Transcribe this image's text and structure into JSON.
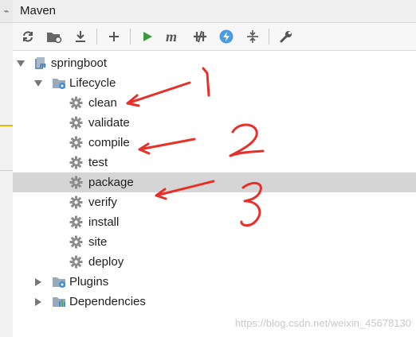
{
  "panel": {
    "title": "Maven"
  },
  "toolbar": {
    "buttons": [
      {
        "name": "reimport-icon"
      },
      {
        "name": "generate-sources-icon"
      },
      {
        "name": "download-icon"
      },
      {
        "name": "add-icon"
      },
      {
        "name": "run-icon"
      },
      {
        "name": "execute-goal-icon"
      },
      {
        "name": "toggle-offline-icon"
      },
      {
        "name": "skip-tests-icon"
      },
      {
        "name": "collapse-all-icon"
      },
      {
        "name": "settings-wrench-icon"
      }
    ]
  },
  "tree": {
    "project": "springboot",
    "lifecycle": "Lifecycle",
    "goals": [
      "clean",
      "validate",
      "compile",
      "test",
      "package",
      "verify",
      "install",
      "site",
      "deploy"
    ],
    "plugins": "Plugins",
    "dependencies": "Dependencies",
    "selected": "package"
  },
  "annotations": [
    "1",
    "2",
    "3"
  ],
  "watermark": "https://blog.csdn.net/weixin_45678130",
  "colors": {
    "run_green": "#3a9b3a",
    "annotation_red": "#e8302a",
    "selection": "#d5d5d5"
  }
}
